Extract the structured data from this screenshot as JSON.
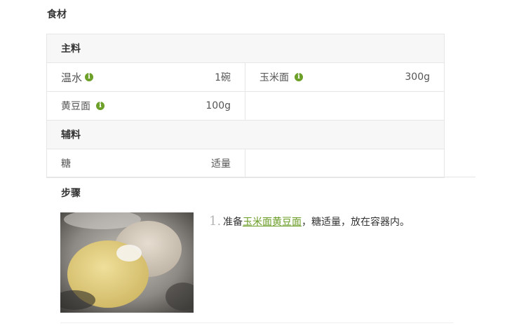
{
  "ingredients": {
    "title": "食材",
    "main": {
      "label": "主料",
      "items": [
        {
          "name": "温水",
          "amount": "1碗"
        },
        {
          "name": "玉米面",
          "amount": "300g"
        },
        {
          "name": "黄豆面",
          "amount": "100g"
        }
      ]
    },
    "aux": {
      "label": "辅料",
      "items": [
        {
          "name": "糖",
          "amount": "适量"
        }
      ]
    },
    "info_icon": "info-icon",
    "accent_color": "#6ca029"
  },
  "steps": {
    "title": "步骤",
    "items": [
      {
        "number": "1.",
        "text_before": "准备",
        "link1": "玉米面",
        "link2": "黄豆面",
        "text_after": "，糖适量，放在容器内。"
      }
    ],
    "link_color": "#6a9c25"
  }
}
